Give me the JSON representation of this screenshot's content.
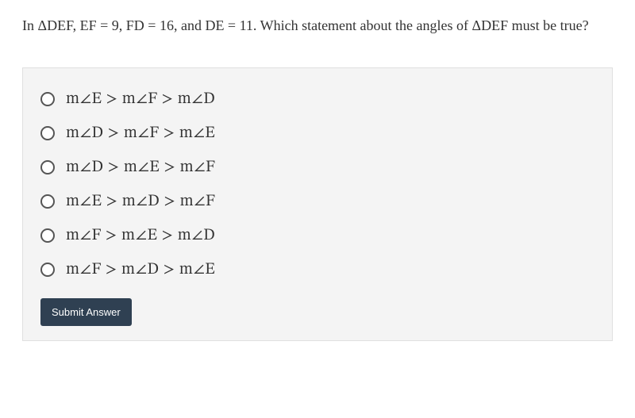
{
  "question": {
    "text": "In ΔDEF, EF = 9, FD = 16, and DE = 11. Which statement about the angles of ΔDEF must be true?"
  },
  "options": [
    {
      "label": "m∠E  >  m∠F  >  m∠D"
    },
    {
      "label": "m∠D  >  m∠F  >  m∠E"
    },
    {
      "label": "m∠D  >  m∠E  >  m∠F"
    },
    {
      "label": "m∠E  >  m∠D  >  m∠F"
    },
    {
      "label": "m∠F  >  m∠E  >  m∠D"
    },
    {
      "label": "m∠F  >  m∠D  >  m∠E"
    }
  ],
  "submit": {
    "label": "Submit Answer"
  }
}
